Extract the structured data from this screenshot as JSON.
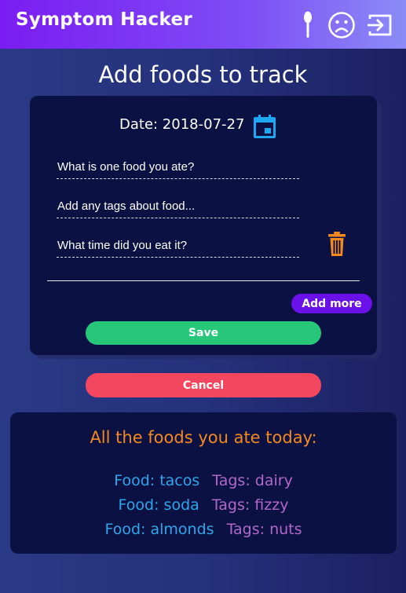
{
  "header": {
    "app_title": "Symptom Hacker",
    "icons": [
      "spoon-icon",
      "sad-face-icon",
      "logout-icon"
    ]
  },
  "page_title": "Add foods to track",
  "form": {
    "date_label": "Date: 2018-07-27",
    "food_field": {
      "placeholder": "What is one food you ate?",
      "value": ""
    },
    "tags_field": {
      "placeholder": "Add any tags about food...",
      "value": ""
    },
    "time_field": {
      "placeholder": "What time did you eat it?",
      "value": ""
    },
    "add_more_label": "Add more",
    "save_label": "Save"
  },
  "cancel_label": "Cancel",
  "foods_today": {
    "title": "All the foods you ate today:",
    "items": [
      {
        "food": "Food: tacos",
        "tags": "Tags: dairy"
      },
      {
        "food": "Food: soda",
        "tags": "Tags: fizzy"
      },
      {
        "food": "Food: almonds",
        "tags": "Tags: nuts"
      }
    ]
  },
  "colors": {
    "header_gradient_start": "#7b1cf2",
    "header_gradient_end": "#8b8cf7",
    "card_bg": "#0b1142",
    "save": "#27c77a",
    "cancel": "#f2475f",
    "add_more": "#6a10e8",
    "calendar_icon": "#1ea7f2",
    "trash_icon": "#f5891f",
    "foods_title": "#f5891f",
    "food_text": "#2fa6ea",
    "tags_text": "#b069c9"
  }
}
